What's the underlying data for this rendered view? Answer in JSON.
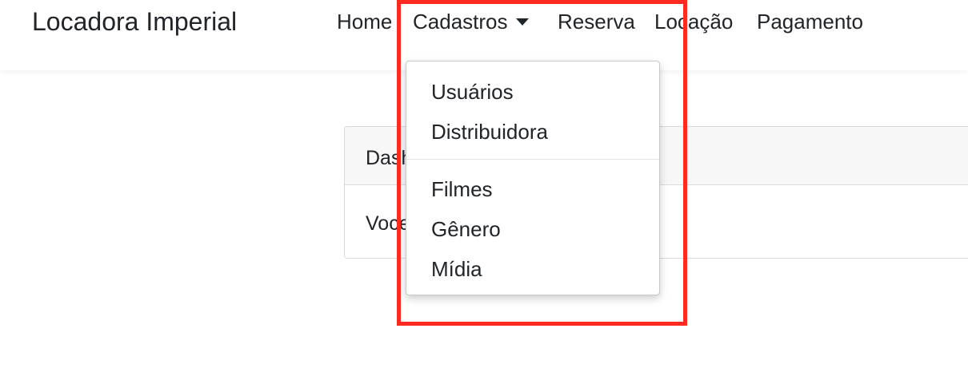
{
  "navbar": {
    "brand": "Locadora Imperial",
    "links": {
      "home": "Home",
      "cadastros": "Cadastros",
      "reserva": "Reserva",
      "locacao": "Locação",
      "pagamento": "Pagamento"
    }
  },
  "card": {
    "header": "Dash",
    "body": "Voce"
  },
  "dropdown": {
    "items": [
      "Usuários",
      "Distribuidora",
      "Filmes",
      "Gênero",
      "Mídia"
    ]
  },
  "colors": {
    "highlight": "#ff2a20",
    "text": "#212529"
  },
  "icons": {
    "cadastros_caret": "caret-down-icon"
  }
}
